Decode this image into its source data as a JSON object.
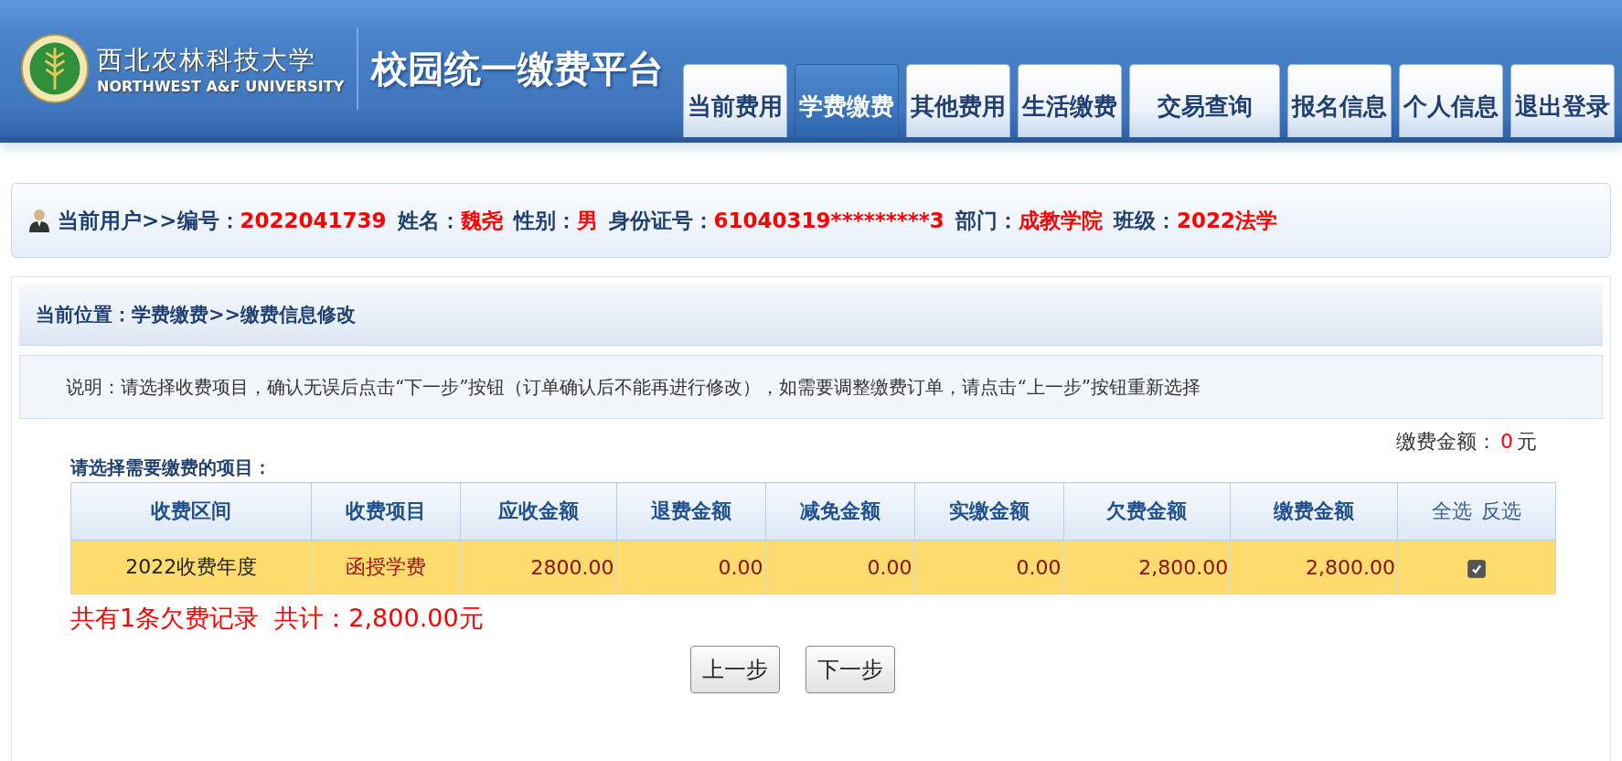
{
  "header": {
    "university_cn": "西北农林科技大学",
    "university_en": "NORTHWEST A&F UNIVERSITY",
    "platform_title": "校园统一缴费平台"
  },
  "tabs": [
    {
      "label": "当前费用",
      "selected": false
    },
    {
      "label": "学费缴费",
      "selected": true
    },
    {
      "label": "其他费用",
      "selected": false
    },
    {
      "label": "生活缴费",
      "selected": false
    },
    {
      "label": "交易查询",
      "selected": false
    },
    {
      "label": "报名信息",
      "selected": false
    },
    {
      "label": "个人信息",
      "selected": false
    },
    {
      "label": "退出登录",
      "selected": false
    }
  ],
  "user_bar": {
    "prefix": "当前用户>>",
    "fields": [
      {
        "label": "编号：",
        "value": "2022041739"
      },
      {
        "label": "姓名：",
        "value": "魏尧"
      },
      {
        "label": "性别：",
        "value": "男"
      },
      {
        "label": "身份证号：",
        "value": "61040319*********3"
      },
      {
        "label": "部门：",
        "value": "成教学院"
      },
      {
        "label": "班级：",
        "value": "2022法学"
      }
    ]
  },
  "breadcrumb": "当前位置：学费缴费>>缴费信息修改",
  "note": "说明：请选择收费项目，确认无误后点击“下一步”按钮（订单确认后不能再进行修改），如需要调整缴费订单，请点击“上一步”按钮重新选择",
  "payment_amount": {
    "label": "缴费金额：",
    "value": "0",
    "unit": "元"
  },
  "table_title": "请选择需要缴费的项目：",
  "table": {
    "columns": [
      "收费区间",
      "收费项目",
      "应收金额",
      "退费金额",
      "减免金额",
      "实缴金额",
      "欠费金额",
      "缴费金额"
    ],
    "select_all": "全选",
    "invert_selection": "反选",
    "rows": [
      {
        "cells": [
          "2022收费年度",
          "函授学费",
          "2800.00",
          "0.00",
          "0.00",
          "0.00",
          "2,800.00",
          "2,800.00"
        ],
        "checked": true
      }
    ]
  },
  "summary": "共有1条欠费记录  共计：2,800.00元",
  "buttons": [
    "上一步",
    "下一步"
  ]
}
